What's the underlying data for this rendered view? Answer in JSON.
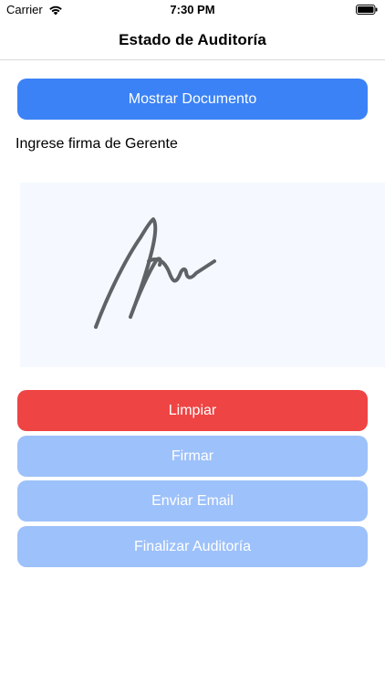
{
  "status_bar": {
    "carrier": "Carrier",
    "time": "7:30 PM",
    "wifi_icon": "wifi-icon",
    "battery_icon": "battery-icon"
  },
  "nav": {
    "title": "Estado de Auditoría"
  },
  "buttons": {
    "show_document": "Mostrar Documento",
    "clear": "Limpiar",
    "sign": "Firmar",
    "send_email": "Enviar Email",
    "finish_audit": "Finalizar Auditoría"
  },
  "signature": {
    "prompt": "Ingrese firma de Gerente"
  },
  "colors": {
    "primary": "#3b82f6",
    "danger": "#ef4444",
    "disabled": "#9dc1fa",
    "pad_background": "#f5f9ff",
    "ink": "#5f6366"
  }
}
